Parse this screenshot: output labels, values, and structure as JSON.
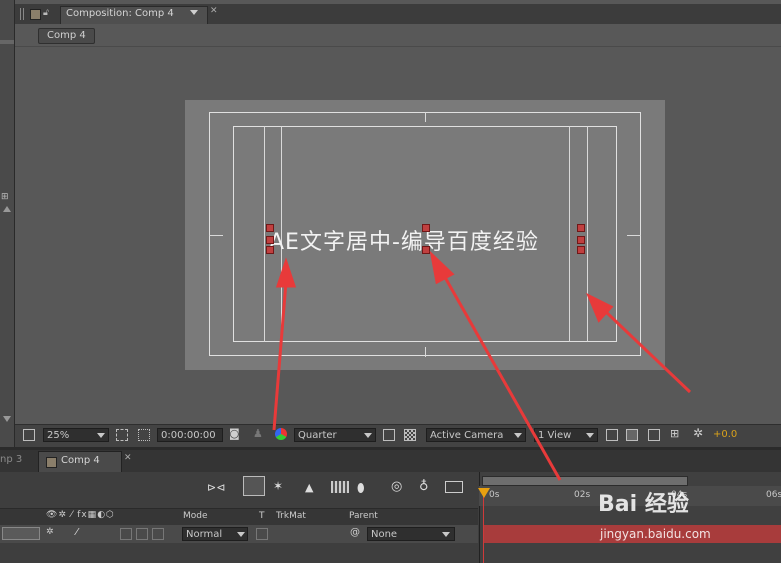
{
  "composition_panel": {
    "tab_title": "Composition: Comp 4",
    "breadcrumb": "Comp 4"
  },
  "canvas": {
    "text": "AE文字居中-编导百度经验"
  },
  "comp_toolbar": {
    "zoom": "25%",
    "timecode": "0:00:00:00",
    "resolution": "Quarter",
    "camera": "Active Camera",
    "view": "1 View",
    "exposure": "+0.0"
  },
  "timeline": {
    "prev_tab": "np 3",
    "tab_title": "Comp 4",
    "columns": {
      "mode": "Mode",
      "t": "T",
      "trkmat": "TrkMat",
      "parent": "Parent"
    },
    "layer": {
      "mode": "Normal",
      "parent": "None"
    },
    "ruler_ticks": [
      "0s",
      "02s",
      "04s",
      "06s"
    ]
  },
  "watermark": {
    "brand": "Bai 经验",
    "url": "jingyan.baidu.com"
  },
  "colors": {
    "arrow": "#e83a3a",
    "layer_bar": "#a83c3c",
    "cti": "#e8a010"
  }
}
